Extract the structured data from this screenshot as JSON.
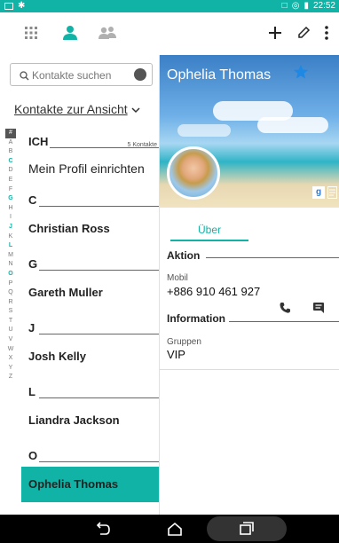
{
  "status_bar": {
    "time": "22:52"
  },
  "toolbar": {
    "icons": [
      "grid-icon",
      "person-icon",
      "people-icon",
      "add-icon",
      "edit-icon",
      "more-vert-icon"
    ]
  },
  "search": {
    "placeholder": "Kontakte suchen"
  },
  "view_filter": {
    "label": "Kontakte zur Ansicht"
  },
  "alphabet": [
    "#",
    "A",
    "B",
    "C",
    "D",
    "E",
    "F",
    "G",
    "H",
    "I",
    "J",
    "K",
    "L",
    "M",
    "N",
    "O",
    "P",
    "Q",
    "R",
    "S",
    "T",
    "U",
    "V",
    "W",
    "X",
    "Y",
    "Z"
  ],
  "alphabet_highlighted": [
    "C",
    "G",
    "J",
    "L",
    "O"
  ],
  "list": {
    "me_section": {
      "letter": "ICH",
      "count": "5 Kontakte"
    },
    "profile_row": "Mein Profil einrichten",
    "sections": [
      {
        "letter": "C",
        "contacts": [
          "Christian Ross"
        ]
      },
      {
        "letter": "G",
        "contacts": [
          "Gareth Muller"
        ]
      },
      {
        "letter": "J",
        "contacts": [
          "Josh Kelly"
        ]
      },
      {
        "letter": "L",
        "contacts": [
          "Liandra Jackson"
        ]
      },
      {
        "letter": "O",
        "contacts": [
          "Ophelia Thomas"
        ]
      }
    ],
    "selected": "Ophelia Thomas"
  },
  "detail": {
    "name": "Ophelia Thomas",
    "tab_label": "Über",
    "action_title": "Aktion",
    "phone_label": "Mobil",
    "phone_value": "+886 910 461 927",
    "info_title": "Information",
    "groups_label": "Gruppen",
    "groups_value": "VIP",
    "google_badge": "g"
  },
  "colors": {
    "accent": "#10b3a6",
    "status_bar": "#10b3a6",
    "selected_row": "#10b3a6",
    "star": "#1e88e5"
  }
}
